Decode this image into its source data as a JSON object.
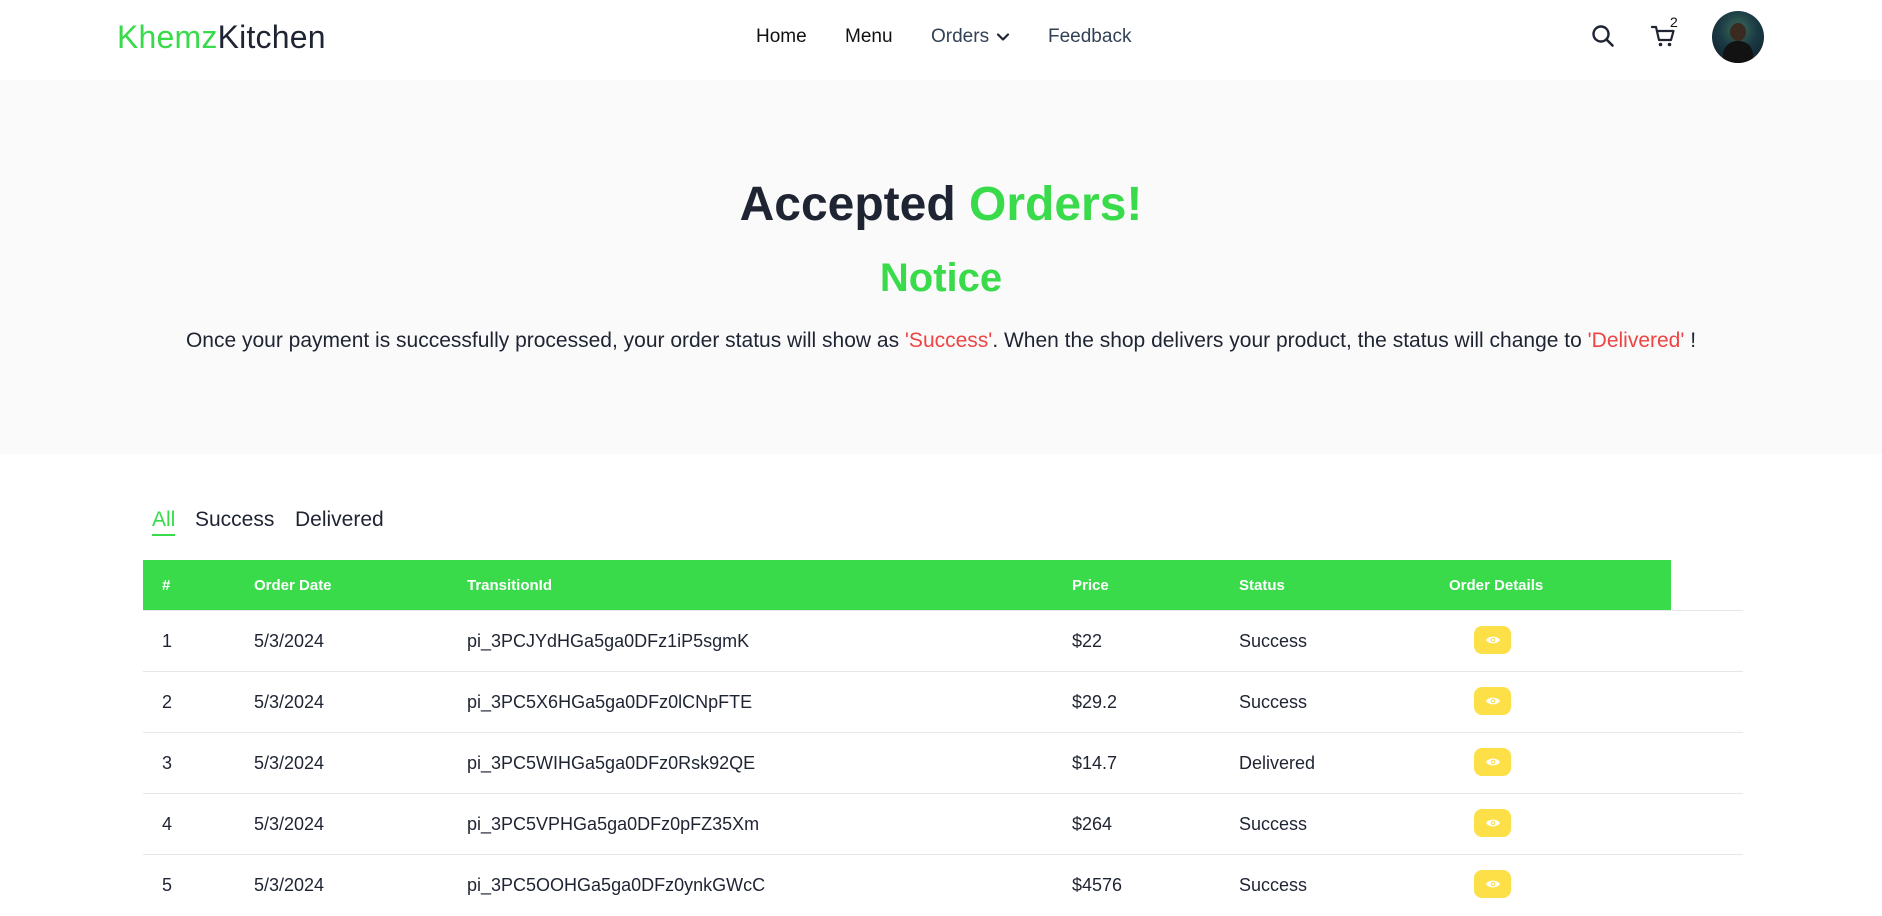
{
  "brand": {
    "part1": "Khemz",
    "part2": "Kitchen"
  },
  "nav": {
    "home": "Home",
    "menu": "Menu",
    "orders": "Orders",
    "feedback": "Feedback",
    "cart_count": "2",
    "icons": {
      "search": "search-icon",
      "cart": "cart-icon",
      "chevron": "chevron-down-icon"
    }
  },
  "hero": {
    "title_part1": "Accepted",
    "title_part2": "Orders!",
    "notice": "Notice",
    "text_part1": "Once your payment is successfully processed, your order status will show as ",
    "status_success": "'Success'",
    "text_part2": ". When the shop delivers your product, the status will change to ",
    "status_delivered": "'Delivered'",
    "text_part3": " !"
  },
  "tabs": [
    "All",
    "Success",
    "Delivered"
  ],
  "active_tab": "All",
  "table": {
    "headers": [
      "#",
      "Order Date",
      "TransitionId",
      "Price",
      "Status",
      "Order Details"
    ],
    "rows": [
      {
        "num": "1",
        "date": "5/3/2024",
        "id": "pi_3PCJYdHGa5ga0DFz1iP5sgmK",
        "price": "$22",
        "status": "Success"
      },
      {
        "num": "2",
        "date": "5/3/2024",
        "id": "pi_3PC5X6HGa5ga0DFz0lCNpFTE",
        "price": "$29.2",
        "status": "Success"
      },
      {
        "num": "3",
        "date": "5/3/2024",
        "id": "pi_3PC5WIHGa5ga0DFz0Rsk92QE",
        "price": "$14.7",
        "status": "Delivered"
      },
      {
        "num": "4",
        "date": "5/3/2024",
        "id": "pi_3PC5VPHGa5ga0DFz0pFZ35Xm",
        "price": "$264",
        "status": "Success"
      },
      {
        "num": "5",
        "date": "5/3/2024",
        "id": "pi_3PC5OOHGa5ga0DFz0ynkGWcC",
        "price": "$4576",
        "status": "Success"
      }
    ]
  },
  "colors": {
    "accent": "#39db4a",
    "highlight": "#ef4444",
    "view_button": "#fde047",
    "text": "#1f2433"
  }
}
